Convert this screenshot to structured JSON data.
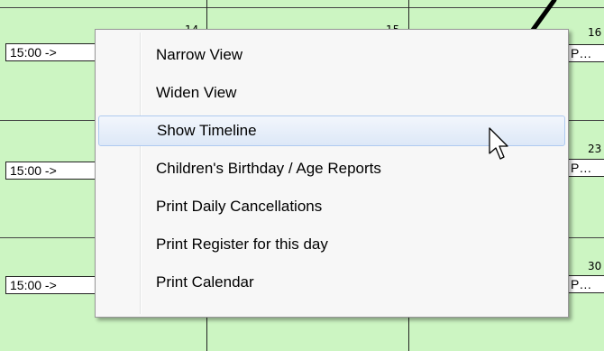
{
  "calendar": {
    "day_numbers": [
      "14",
      "15",
      "16",
      "23",
      "30"
    ],
    "event_left_text": "15:00 ->",
    "event_right_text": "P…"
  },
  "context_menu": {
    "items": [
      {
        "label": "Narrow View"
      },
      {
        "label": "Widen View"
      },
      {
        "label": "Show Timeline",
        "highlighted": true
      },
      {
        "label": "Children's Birthday / Age Reports"
      },
      {
        "label": "Print Daily Cancellations"
      },
      {
        "label": "Print Register for this day"
      },
      {
        "label": "Print Calendar"
      }
    ]
  },
  "colors": {
    "calendar_background": "#ccf5c2",
    "menu_background": "#f7f7f7",
    "highlight_border": "#aecaf0"
  },
  "icons": [
    "annotation-arrow-icon",
    "mouse-pointer-icon"
  ]
}
